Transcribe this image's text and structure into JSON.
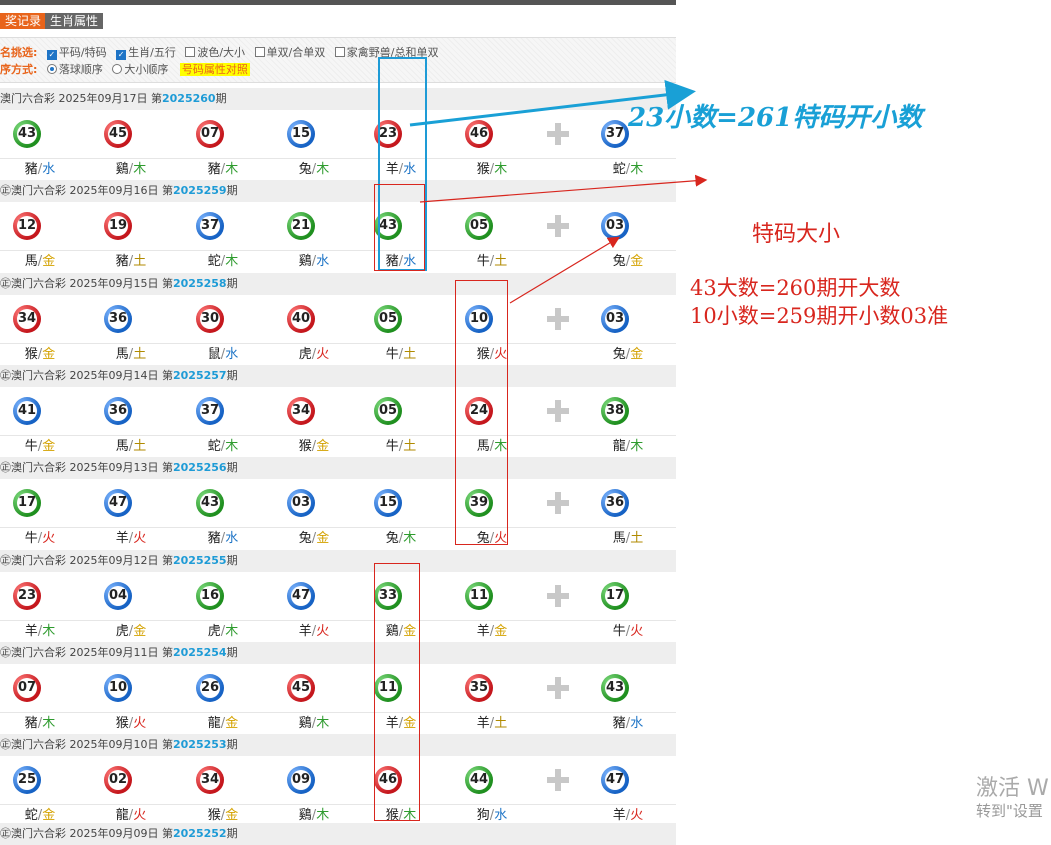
{
  "tabs": [
    "奖记录",
    "生肖属性"
  ],
  "options": {
    "row1_label": "名挑选:",
    "row1_items": [
      {
        "label": "平码/特码",
        "checked": true
      },
      {
        "label": "生肖/五行",
        "checked": true
      },
      {
        "label": "波色/大小",
        "checked": false
      },
      {
        "label": "单双/合单双",
        "checked": false
      },
      {
        "label": "家禽野兽/总和单双",
        "checked": false
      }
    ],
    "row2_label": "序方式:",
    "row2_items": [
      {
        "label": "落球顺序",
        "checked": true
      },
      {
        "label": "大小顺序",
        "checked": false
      }
    ],
    "row2_highlight": "号码属性对照"
  },
  "draws": [
    {
      "title": "澳门六合彩 2025年09月17日 第",
      "period": "2025260",
      "suffix": "期",
      "nums": [
        "43",
        "45",
        "07",
        "15",
        "23",
        "46",
        "37"
      ],
      "colors": [
        "green",
        "red",
        "red",
        "blue",
        "red",
        "red",
        "blue"
      ],
      "zodiac": [
        "豬",
        "鷄",
        "豬",
        "兔",
        "羊",
        "猴",
        "蛇"
      ],
      "elements": [
        "水",
        "木",
        "木",
        "木",
        "水",
        "木",
        "木"
      ],
      "ecls": [
        "water",
        "wood",
        "wood",
        "wood",
        "water",
        "wood",
        "wood"
      ]
    },
    {
      "title": "㊣澳门六合彩 2025年09月16日 第",
      "period": "2025259",
      "suffix": "期",
      "nums": [
        "12",
        "19",
        "37",
        "21",
        "43",
        "05",
        "03"
      ],
      "colors": [
        "red",
        "red",
        "blue",
        "green",
        "green",
        "green",
        "blue"
      ],
      "zodiac": [
        "馬",
        "豬",
        "蛇",
        "鷄",
        "豬",
        "牛",
        "兔"
      ],
      "elements": [
        "金",
        "土",
        "木",
        "水",
        "水",
        "土",
        "金"
      ],
      "ecls": [
        "gold",
        "earth",
        "wood",
        "water",
        "water",
        "earth",
        "gold"
      ]
    },
    {
      "title": "㊣澳门六合彩 2025年09月15日 第",
      "period": "2025258",
      "suffix": "期",
      "nums": [
        "34",
        "36",
        "30",
        "40",
        "05",
        "10",
        "03"
      ],
      "colors": [
        "red",
        "blue",
        "red",
        "red",
        "green",
        "blue",
        "blue"
      ],
      "zodiac": [
        "猴",
        "馬",
        "鼠",
        "虎",
        "牛",
        "猴",
        "兔"
      ],
      "elements": [
        "金",
        "土",
        "水",
        "火",
        "土",
        "火",
        "金"
      ],
      "ecls": [
        "gold",
        "earth",
        "water",
        "fire",
        "earth",
        "fire",
        "gold"
      ]
    },
    {
      "title": "㊣澳门六合彩 2025年09月14日 第",
      "period": "2025257",
      "suffix": "期",
      "nums": [
        "41",
        "36",
        "37",
        "34",
        "05",
        "24",
        "38"
      ],
      "colors": [
        "blue",
        "blue",
        "blue",
        "red",
        "green",
        "red",
        "green"
      ],
      "zodiac": [
        "牛",
        "馬",
        "蛇",
        "猴",
        "牛",
        "馬",
        "龍"
      ],
      "elements": [
        "金",
        "土",
        "木",
        "金",
        "土",
        "木",
        "木"
      ],
      "ecls": [
        "gold",
        "earth",
        "wood",
        "gold",
        "earth",
        "wood",
        "wood"
      ]
    },
    {
      "title": "㊣澳门六合彩 2025年09月13日 第",
      "period": "2025256",
      "suffix": "期",
      "nums": [
        "17",
        "47",
        "43",
        "03",
        "15",
        "39",
        "36"
      ],
      "colors": [
        "green",
        "blue",
        "green",
        "blue",
        "blue",
        "green",
        "blue"
      ],
      "zodiac": [
        "牛",
        "羊",
        "豬",
        "兔",
        "兔",
        "兔",
        "馬"
      ],
      "elements": [
        "火",
        "火",
        "水",
        "金",
        "木",
        "火",
        "土"
      ],
      "ecls": [
        "fire",
        "fire",
        "water",
        "gold",
        "wood",
        "fire",
        "earth"
      ]
    },
    {
      "title": "㊣澳门六合彩 2025年09月12日 第",
      "period": "2025255",
      "suffix": "期",
      "nums": [
        "23",
        "04",
        "16",
        "47",
        "33",
        "11",
        "17"
      ],
      "colors": [
        "red",
        "blue",
        "green",
        "blue",
        "green",
        "green",
        "green"
      ],
      "zodiac": [
        "羊",
        "虎",
        "虎",
        "羊",
        "鷄",
        "羊",
        "牛"
      ],
      "elements": [
        "木",
        "金",
        "木",
        "火",
        "金",
        "金",
        "火"
      ],
      "ecls": [
        "wood",
        "gold",
        "wood",
        "fire",
        "gold",
        "gold",
        "fire"
      ]
    },
    {
      "title": "㊣澳门六合彩 2025年09月11日 第",
      "period": "2025254",
      "suffix": "期",
      "nums": [
        "07",
        "10",
        "26",
        "45",
        "11",
        "35",
        "43"
      ],
      "colors": [
        "red",
        "blue",
        "blue",
        "red",
        "green",
        "red",
        "green"
      ],
      "zodiac": [
        "豬",
        "猴",
        "龍",
        "鷄",
        "羊",
        "羊",
        "豬"
      ],
      "elements": [
        "木",
        "火",
        "金",
        "木",
        "金",
        "土",
        "水"
      ],
      "ecls": [
        "wood",
        "fire",
        "gold",
        "wood",
        "gold",
        "earth",
        "water"
      ]
    },
    {
      "title": "㊣澳门六合彩 2025年09月10日 第",
      "period": "2025253",
      "suffix": "期",
      "nums": [
        "25",
        "02",
        "34",
        "09",
        "46",
        "44",
        "47"
      ],
      "colors": [
        "blue",
        "red",
        "red",
        "blue",
        "red",
        "green",
        "blue"
      ],
      "zodiac": [
        "蛇",
        "龍",
        "猴",
        "鷄",
        "猴",
        "狗",
        "羊"
      ],
      "elements": [
        "金",
        "火",
        "金",
        "木",
        "木",
        "水",
        "火"
      ],
      "ecls": [
        "gold",
        "fire",
        "gold",
        "wood",
        "wood",
        "water",
        "fire"
      ]
    }
  ],
  "last_header": {
    "title": "㊣澳门六合彩 2025年09月09日 第",
    "period": "2025252",
    "suffix": "期"
  },
  "annotations": {
    "blue_text": "23小数=261特码开小数",
    "red_title": "特码大小",
    "red_line1": "43大数=260期开大数",
    "red_line2": "10小数=259期开小数03准"
  },
  "watermark": {
    "line1": "激活 W",
    "line2": "转到\"设置"
  },
  "colors": {
    "accent_orange": "#e8641b",
    "period_blue": "#1e9bd6",
    "annot_blue": "#19a0d6",
    "annot_red": "#d8261e"
  }
}
